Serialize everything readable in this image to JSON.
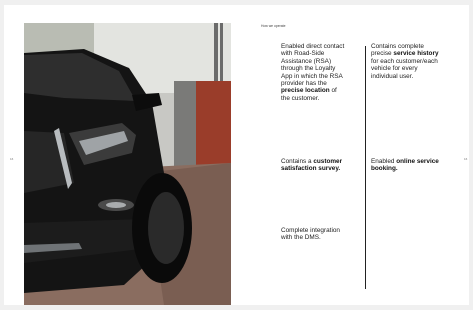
{
  "header": {
    "section_title": "How we operate"
  },
  "page_numbers": {
    "left": "16",
    "right": "16"
  },
  "photo": {
    "subject": "car-photo"
  },
  "features": {
    "left_column": [
      {
        "pre": "Enabled direct contact with Road-Side Assistance (RSA) through the Loyalty App in which the RSA provider has the ",
        "bold": "precise location",
        "post": " of the customer."
      },
      {
        "pre": "Contains a ",
        "bold": "customer satisfaction survey.",
        "post": ""
      },
      {
        "pre": "Complete integration with the DMS.",
        "bold": "",
        "post": ""
      }
    ],
    "right_column": [
      {
        "pre": "Contains complete precise ",
        "bold": "service history",
        "post": " for each customer/each vehicle for every individual user."
      },
      {
        "pre": "Enabled ",
        "bold": "online service booking.",
        "post": ""
      }
    ]
  }
}
